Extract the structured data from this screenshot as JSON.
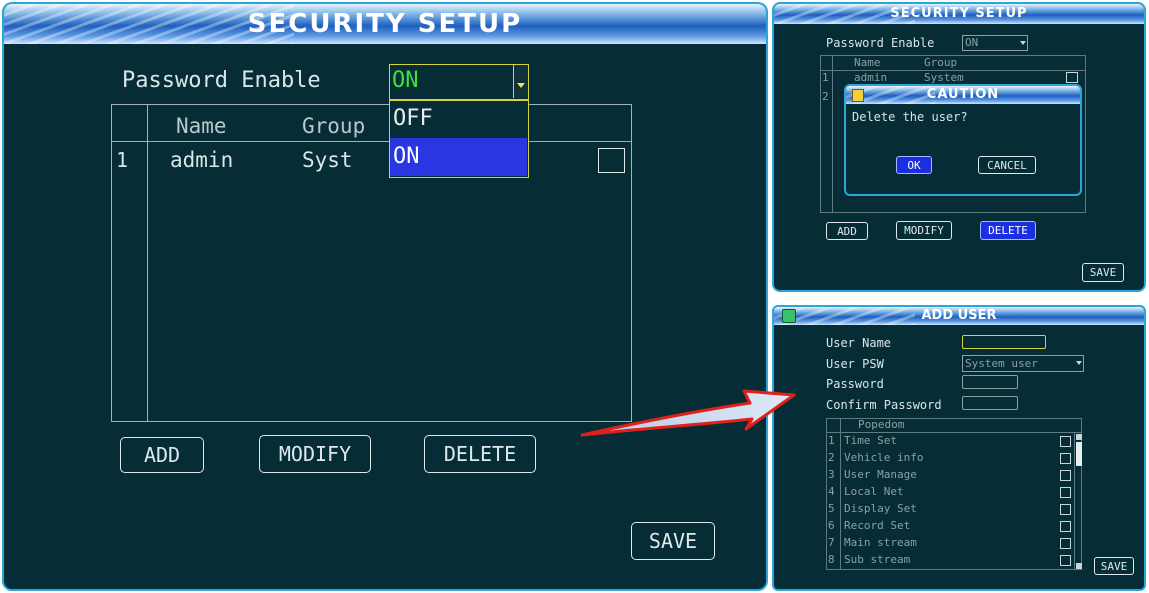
{
  "main": {
    "title": "SECURITY SETUP",
    "password_enable_label": "Password Enable",
    "password_enable_value": "ON",
    "dropdown_options": [
      "OFF",
      "ON"
    ],
    "table_headers": [
      "Name",
      "Group"
    ],
    "rows": [
      {
        "index": "1",
        "name": "admin",
        "group": "Syst"
      }
    ],
    "buttons": {
      "add": "ADD",
      "modify": "MODIFY",
      "delete": "DELETE",
      "save": "SAVE"
    }
  },
  "caution_panel": {
    "title": "SECURITY SETUP",
    "password_enable_label": "Password Enable",
    "password_enable_value": "ON",
    "table_headers": [
      "Name",
      "Group"
    ],
    "rows": [
      {
        "index": "1",
        "name": "admin",
        "group": "System"
      },
      {
        "index": "2"
      }
    ],
    "dialog": {
      "title": "CAUTION",
      "message": "Delete the user?",
      "ok": "OK",
      "cancel": "CANCEL"
    },
    "buttons": {
      "add": "ADD",
      "modify": "MODIFY",
      "delete": "DELETE",
      "save": "SAVE"
    }
  },
  "add_user": {
    "title": "ADD USER",
    "user_name_label": "User Name",
    "user_psw_label": "User PSW",
    "user_psw_value": "System user",
    "password_label": "Password",
    "confirm_password_label": "Confirm Password",
    "popedom_header": "Popedom",
    "popedom": [
      {
        "index": "1",
        "label": "Time Set"
      },
      {
        "index": "2",
        "label": "Vehicle info"
      },
      {
        "index": "3",
        "label": "User Manage"
      },
      {
        "index": "4",
        "label": "Local Net"
      },
      {
        "index": "5",
        "label": "Display Set"
      },
      {
        "index": "6",
        "label": "Record Set"
      },
      {
        "index": "7",
        "label": "Main stream"
      },
      {
        "index": "8",
        "label": "Sub stream"
      }
    ],
    "save": "SAVE"
  },
  "colors": {
    "panel_bg": "#062c36",
    "border": "#2aa7d6",
    "accent_blue": "#1b2fe0",
    "dropdown_yellow": "#d6d23a",
    "arrow_red": "#e0201a"
  }
}
